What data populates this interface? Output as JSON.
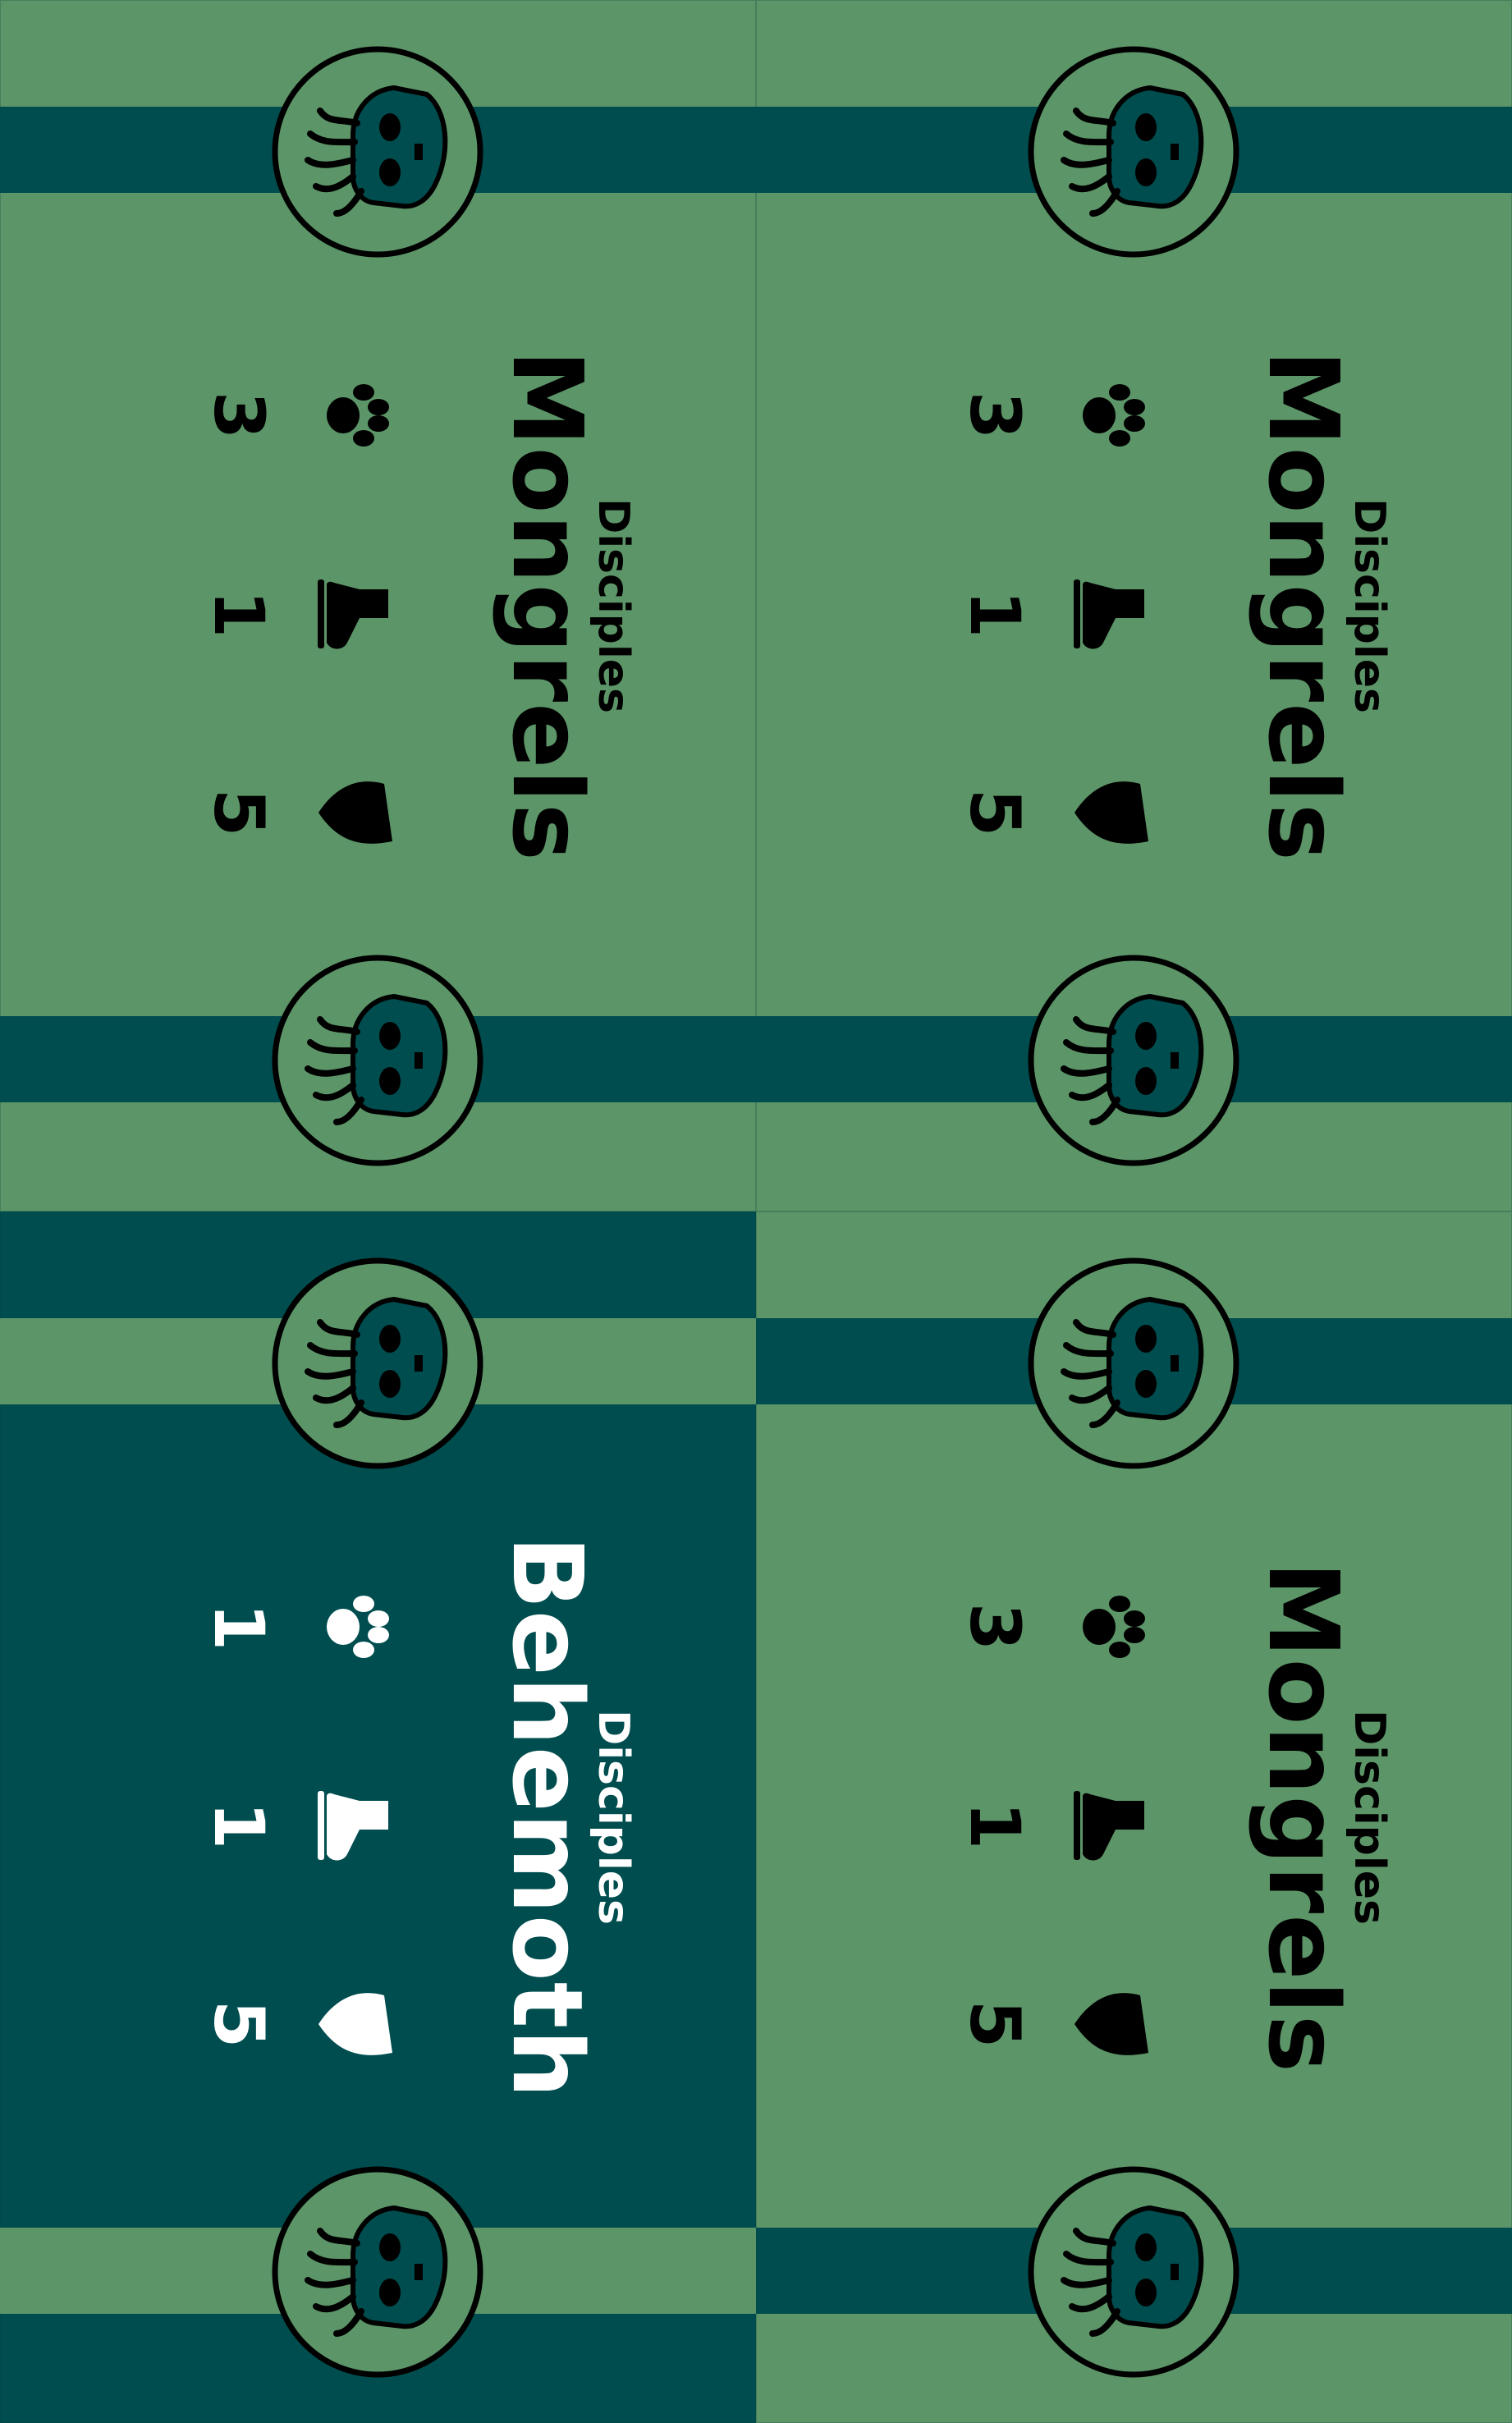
{
  "colors": {
    "green": "#5c9568",
    "teal": "#004d4f",
    "ink_dark": "#000000",
    "ink_light": "#ffffff"
  },
  "cards": [
    {
      "id": "top-left",
      "faction": "Disciples",
      "name": "Mongrels",
      "theme": "light",
      "stats": {
        "attack": "3",
        "move": "1",
        "defense": "5"
      }
    },
    {
      "id": "top-right",
      "faction": "Disciples",
      "name": "Mongrels",
      "theme": "light",
      "stats": {
        "attack": "3",
        "move": "1",
        "defense": "5"
      }
    },
    {
      "id": "bottom-left",
      "faction": "Disciples",
      "name": "Behemoth",
      "theme": "dark",
      "stats": {
        "attack": "1",
        "move": "1",
        "defense": "5"
      }
    },
    {
      "id": "bottom-right",
      "faction": "Disciples",
      "name": "Mongrels",
      "theme": "light",
      "stats": {
        "attack": "3",
        "move": "1",
        "defense": "5"
      }
    }
  ],
  "icons": {
    "emblem": "tentacle-skull-icon",
    "attack": "paw-print-icon",
    "move": "boot-icon",
    "defense": "shield-icon"
  }
}
